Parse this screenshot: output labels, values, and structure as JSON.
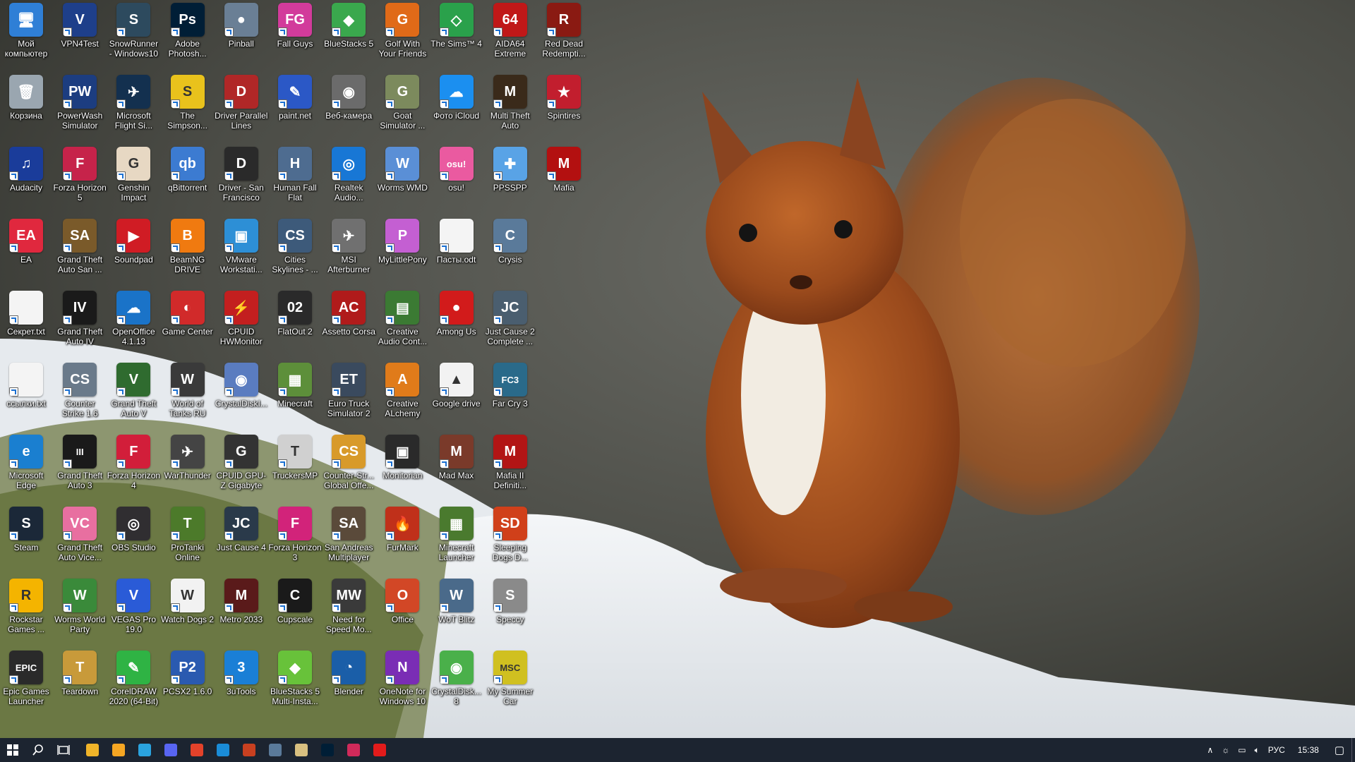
{
  "wallpaper": {
    "subject": "squirrel-in-snow"
  },
  "desktop_icons": [
    {
      "label": "Мой компьютер",
      "color": "#2f7fd6",
      "glyph": "🖥",
      "col": 0,
      "row": 0
    },
    {
      "label": "VPN4Test",
      "color": "#1e3f8a",
      "glyph": "V",
      "col": 1,
      "row": 0
    },
    {
      "label": "SnowRunner - Windows10",
      "color": "#2d4a5e",
      "glyph": "S",
      "col": 2,
      "row": 0
    },
    {
      "label": "Adobe Photosh...",
      "color": "#001e36",
      "glyph": "Ps",
      "col": 3,
      "row": 0
    },
    {
      "label": "Pinball",
      "color": "#6a7f95",
      "glyph": "●",
      "col": 4,
      "row": 0
    },
    {
      "label": "Fall Guys",
      "color": "#d23b9b",
      "glyph": "FG",
      "col": 5,
      "row": 0
    },
    {
      "label": "BlueStacks 5",
      "color": "#3aa84d",
      "glyph": "◆",
      "col": 6,
      "row": 0
    },
    {
      "label": "Golf With Your Friends",
      "color": "#e06a18",
      "glyph": "G",
      "col": 7,
      "row": 0
    },
    {
      "label": "The Sims™ 4",
      "color": "#2aa14b",
      "glyph": "◇",
      "col": 8,
      "row": 0
    },
    {
      "label": "AIDA64 Extreme",
      "color": "#c01818",
      "glyph": "64",
      "col": 9,
      "row": 0
    },
    {
      "label": "Red Dead Redempti...",
      "color": "#8a1a12",
      "glyph": "R",
      "col": 10,
      "row": 0
    },
    {
      "label": "Корзина",
      "color": "#9aa6b0",
      "glyph": "🗑",
      "col": 0,
      "row": 1
    },
    {
      "label": "PowerWash Simulator",
      "color": "#1c3d80",
      "glyph": "PW",
      "col": 1,
      "row": 1
    },
    {
      "label": "Microsoft Flight Si...",
      "color": "#13304f",
      "glyph": "✈",
      "col": 2,
      "row": 1
    },
    {
      "label": "The Simpson...",
      "color": "#e9c21c",
      "glyph": "S",
      "col": 3,
      "row": 1
    },
    {
      "label": "Driver Parallel Lines",
      "color": "#b02727",
      "glyph": "D",
      "col": 4,
      "row": 1
    },
    {
      "label": "paint.net",
      "color": "#2b58c6",
      "glyph": "✎",
      "col": 5,
      "row": 1
    },
    {
      "label": "Веб-камера",
      "color": "#6b6b6b",
      "glyph": "◉",
      "col": 6,
      "row": 1
    },
    {
      "label": "Goat Simulator ...",
      "color": "#7c8a5d",
      "glyph": "G",
      "col": 7,
      "row": 1
    },
    {
      "label": "Фото iCloud",
      "color": "#1b8ff0",
      "glyph": "☁",
      "col": 8,
      "row": 1
    },
    {
      "label": "Multi Theft Auto",
      "color": "#3a2a1a",
      "glyph": "M",
      "col": 9,
      "row": 1
    },
    {
      "label": "Spintires",
      "color": "#c21e2e",
      "glyph": "★",
      "col": 10,
      "row": 1
    },
    {
      "label": "Audacity",
      "color": "#1a3c9a",
      "glyph": "♫",
      "col": 0,
      "row": 2
    },
    {
      "label": "Forza Horizon 5",
      "color": "#c6234a",
      "glyph": "F",
      "col": 1,
      "row": 2
    },
    {
      "label": "Genshin Impact",
      "color": "#e7d8c3",
      "glyph": "G",
      "col": 2,
      "row": 2
    },
    {
      "label": "qBittorrent",
      "color": "#3c7bd1",
      "glyph": "qb",
      "col": 3,
      "row": 2
    },
    {
      "label": "Driver - San Francisco",
      "color": "#2a2a2a",
      "glyph": "D",
      "col": 4,
      "row": 2
    },
    {
      "label": "Human Fall Flat",
      "color": "#4e6c90",
      "glyph": "H",
      "col": 5,
      "row": 2
    },
    {
      "label": "Realtek Audio...",
      "color": "#1877d5",
      "glyph": "◎",
      "col": 6,
      "row": 2
    },
    {
      "label": "Worms WMD",
      "color": "#5a8fd6",
      "glyph": "W",
      "col": 7,
      "row": 2
    },
    {
      "label": "osu!",
      "color": "#ea5aa0",
      "glyph": "osu!",
      "col": 8,
      "row": 2
    },
    {
      "label": "PPSSPP",
      "color": "#59a3e6",
      "glyph": "✚",
      "col": 9,
      "row": 2
    },
    {
      "label": "Mafia",
      "color": "#b31010",
      "glyph": "M",
      "col": 10,
      "row": 2
    },
    {
      "label": "EA",
      "color": "#e0283e",
      "glyph": "EA",
      "col": 0,
      "row": 3
    },
    {
      "label": "Grand Theft Auto San ...",
      "color": "#7a5a2a",
      "glyph": "SA",
      "col": 1,
      "row": 3
    },
    {
      "label": "Soundpad",
      "color": "#d01c24",
      "glyph": "▶",
      "col": 2,
      "row": 3
    },
    {
      "label": "BeamNG DRIVE",
      "color": "#f07a10",
      "glyph": "B",
      "col": 3,
      "row": 3
    },
    {
      "label": "VMware Workstati...",
      "color": "#2d8fd6",
      "glyph": "▣",
      "col": 4,
      "row": 3
    },
    {
      "label": "Cities Skylines - ...",
      "color": "#3d5a7a",
      "glyph": "CS",
      "col": 5,
      "row": 3
    },
    {
      "label": "MSI Afterburner",
      "color": "#707070",
      "glyph": "✈",
      "col": 6,
      "row": 3
    },
    {
      "label": "MyLittlePony",
      "color": "#c45fd2",
      "glyph": "P",
      "col": 7,
      "row": 3
    },
    {
      "label": "Пасты.odt",
      "color": "#f4f4f4",
      "glyph": "",
      "col": 8,
      "row": 3
    },
    {
      "label": "Crysis",
      "color": "#5a7a9a",
      "glyph": "C",
      "col": 9,
      "row": 3
    },
    {
      "label": "Секрет.txt",
      "color": "#f4f4f4",
      "glyph": "",
      "col": 0,
      "row": 4
    },
    {
      "label": "Grand Theft Auto IV",
      "color": "#1a1a1a",
      "glyph": "IV",
      "col": 1,
      "row": 4
    },
    {
      "label": "OpenOffice 4.1.13",
      "color": "#1a73c8",
      "glyph": "☁",
      "col": 2,
      "row": 4
    },
    {
      "label": "Game Center",
      "color": "#d12a2a",
      "glyph": "◐",
      "col": 3,
      "row": 4
    },
    {
      "label": "CPUID HWMonitor",
      "color": "#c31f1f",
      "glyph": "⚡",
      "col": 4,
      "row": 4
    },
    {
      "label": "FlatOut 2",
      "color": "#2a2a2a",
      "glyph": "02",
      "col": 5,
      "row": 4
    },
    {
      "label": "Assetto Corsa",
      "color": "#b01b1b",
      "glyph": "AC",
      "col": 6,
      "row": 4
    },
    {
      "label": "Creative Audio Cont...",
      "color": "#3b7a33",
      "glyph": "▤",
      "col": 7,
      "row": 4
    },
    {
      "label": "Among Us",
      "color": "#d21b1b",
      "glyph": "●",
      "col": 8,
      "row": 4
    },
    {
      "label": "Just Cause 2 Complete ...",
      "color": "#4a5e6f",
      "glyph": "JC",
      "col": 9,
      "row": 4
    },
    {
      "label": "ссылки.txt",
      "color": "#f4f4f4",
      "glyph": "",
      "col": 0,
      "row": 5
    },
    {
      "label": "Counter Strike 1.6",
      "color": "#6a7a8a",
      "glyph": "CS",
      "col": 1,
      "row": 5
    },
    {
      "label": "Grand Theft Auto V",
      "color": "#2f6b2f",
      "glyph": "V",
      "col": 2,
      "row": 5
    },
    {
      "label": "World of Tanks RU",
      "color": "#3a3a3a",
      "glyph": "W",
      "col": 3,
      "row": 5
    },
    {
      "label": "CrystalDiskI...",
      "color": "#5a7cc0",
      "glyph": "◉",
      "col": 4,
      "row": 5
    },
    {
      "label": "Minecraft",
      "color": "#5d8f3a",
      "glyph": "▦",
      "col": 5,
      "row": 5
    },
    {
      "label": "Euro Truck Simulator 2",
      "color": "#3a4a5e",
      "glyph": "ET",
      "col": 6,
      "row": 5
    },
    {
      "label": "Creative ALchemy",
      "color": "#e07b1a",
      "glyph": "A",
      "col": 7,
      "row": 5
    },
    {
      "label": "Google drive",
      "color": "#f2f2f2",
      "glyph": "▲",
      "col": 8,
      "row": 5
    },
    {
      "label": "Far Cry 3",
      "color": "#2a6a8a",
      "glyph": "FC3",
      "col": 9,
      "row": 5
    },
    {
      "label": "Microsoft Edge",
      "color": "#1a7fd0",
      "glyph": "e",
      "col": 0,
      "row": 6
    },
    {
      "label": "Grand Theft Auto 3",
      "color": "#1a1a1a",
      "glyph": "III",
      "col": 1,
      "row": 6
    },
    {
      "label": "Forza Horizon 4",
      "color": "#d21e3a",
      "glyph": "F",
      "col": 2,
      "row": 6
    },
    {
      "label": "WarThunder",
      "color": "#444",
      "glyph": "✈",
      "col": 3,
      "row": 6
    },
    {
      "label": "CPUID GPU-Z Gigabyte",
      "color": "#333",
      "glyph": "G",
      "col": 4,
      "row": 6
    },
    {
      "label": "TruckersMP",
      "color": "#d0d0d0",
      "glyph": "T",
      "col": 5,
      "row": 6
    },
    {
      "label": "Counter-Str... Global Offe...",
      "color": "#d89a2a",
      "glyph": "CS",
      "col": 6,
      "row": 6
    },
    {
      "label": "Monitorian",
      "color": "#2a2a2a",
      "glyph": "▣",
      "col": 7,
      "row": 6
    },
    {
      "label": "Mad Max",
      "color": "#7a3a2a",
      "glyph": "M",
      "col": 8,
      "row": 6
    },
    {
      "label": "Mafia II Definiti...",
      "color": "#b21515",
      "glyph": "M",
      "col": 9,
      "row": 6
    },
    {
      "label": "Steam",
      "color": "#1b2838",
      "glyph": "S",
      "col": 0,
      "row": 7
    },
    {
      "label": "Grand Theft Auto Vice...",
      "color": "#e86fa0",
      "glyph": "VC",
      "col": 1,
      "row": 7
    },
    {
      "label": "OBS Studio",
      "color": "#302e31",
      "glyph": "◎",
      "col": 2,
      "row": 7
    },
    {
      "label": "ProTanki Online",
      "color": "#4c7a2a",
      "glyph": "T",
      "col": 3,
      "row": 7
    },
    {
      "label": "Just Cause 4",
      "color": "#2a3a4a",
      "glyph": "JC",
      "col": 4,
      "row": 7
    },
    {
      "label": "Forza Horizon 3",
      "color": "#d2237a",
      "glyph": "F",
      "col": 5,
      "row": 7
    },
    {
      "label": "San Andreas Multiplayer",
      "color": "#5a4a3a",
      "glyph": "SA",
      "col": 6,
      "row": 7
    },
    {
      "label": "FurMark",
      "color": "#c0301a",
      "glyph": "🔥",
      "col": 7,
      "row": 7
    },
    {
      "label": "Minecraft Launcher",
      "color": "#4a7a2e",
      "glyph": "▦",
      "col": 8,
      "row": 7
    },
    {
      "label": "Sleeping Dogs D...",
      "color": "#d0401a",
      "glyph": "SD",
      "col": 9,
      "row": 7
    },
    {
      "label": "Rockstar Games ...",
      "color": "#f4b400",
      "glyph": "R",
      "col": 0,
      "row": 8
    },
    {
      "label": "Worms World Party",
      "color": "#3a8a3a",
      "glyph": "W",
      "col": 1,
      "row": 8
    },
    {
      "label": "VEGAS Pro 19.0",
      "color": "#2a5bd7",
      "glyph": "V",
      "col": 2,
      "row": 8
    },
    {
      "label": "Watch Dogs 2",
      "color": "#f2f2f2",
      "glyph": "W",
      "col": 3,
      "row": 8
    },
    {
      "label": "Metro 2033",
      "color": "#5a1a1a",
      "glyph": "M",
      "col": 4,
      "row": 8
    },
    {
      "label": "Cupscale",
      "color": "#1a1a1a",
      "glyph": "C",
      "col": 5,
      "row": 8
    },
    {
      "label": "Need for Speed Mo...",
      "color": "#3a3a3a",
      "glyph": "MW",
      "col": 6,
      "row": 8
    },
    {
      "label": "Office",
      "color": "#d24726",
      "glyph": "O",
      "col": 7,
      "row": 8
    },
    {
      "label": "WoT Blitz",
      "color": "#4a6a8a",
      "glyph": "W",
      "col": 8,
      "row": 8
    },
    {
      "label": "Speccy",
      "color": "#8a8a8a",
      "glyph": "S",
      "col": 9,
      "row": 8
    },
    {
      "label": "Epic Games Launcher",
      "color": "#2a2a2a",
      "glyph": "EPIC",
      "col": 0,
      "row": 9
    },
    {
      "label": "Teardown",
      "color": "#c89a3a",
      "glyph": "T",
      "col": 1,
      "row": 9
    },
    {
      "label": "CorelDRAW 2020 (64-Bit)",
      "color": "#2fb344",
      "glyph": "✎",
      "col": 2,
      "row": 9
    },
    {
      "label": "PCSX2 1.6.0",
      "color": "#2a5ab0",
      "glyph": "P2",
      "col": 3,
      "row": 9
    },
    {
      "label": "3uTools",
      "color": "#1a7fd6",
      "glyph": "3",
      "col": 4,
      "row": 9
    },
    {
      "label": "BlueStacks 5 Multi-Insta...",
      "color": "#68c23a",
      "glyph": "◆",
      "col": 5,
      "row": 9
    },
    {
      "label": "Blender",
      "color": "#1a5ea8",
      "glyph": "◔",
      "col": 6,
      "row": 9
    },
    {
      "label": "OneNote for Windows 10",
      "color": "#7a2db5",
      "glyph": "N",
      "col": 7,
      "row": 9
    },
    {
      "label": "CrystalDisk... 8",
      "color": "#4ab04a",
      "glyph": "◉",
      "col": 8,
      "row": 9
    },
    {
      "label": "My Summer Car",
      "color": "#d0c020",
      "glyph": "MSC",
      "col": 9,
      "row": 9
    }
  ],
  "taskbar": {
    "apps": [
      {
        "name": "file-explorer",
        "color": "#f0b429"
      },
      {
        "name": "yandex-browser",
        "color": "#f5a623"
      },
      {
        "name": "telegram",
        "color": "#2aa3df"
      },
      {
        "name": "discord",
        "color": "#5865f2"
      },
      {
        "name": "chrome",
        "color": "#e3422a"
      },
      {
        "name": "edge",
        "color": "#1a8cd8"
      },
      {
        "name": "torch",
        "color": "#c84020"
      },
      {
        "name": "photos",
        "color": "#5a7a9a"
      },
      {
        "name": "paint",
        "color": "#d8c080"
      },
      {
        "name": "photoshop",
        "color": "#001e36"
      },
      {
        "name": "app-red",
        "color": "#d02a5a"
      },
      {
        "name": "youtube",
        "color": "#e21b1b"
      }
    ],
    "tray": {
      "language": "РУС",
      "time": "15:38"
    }
  }
}
